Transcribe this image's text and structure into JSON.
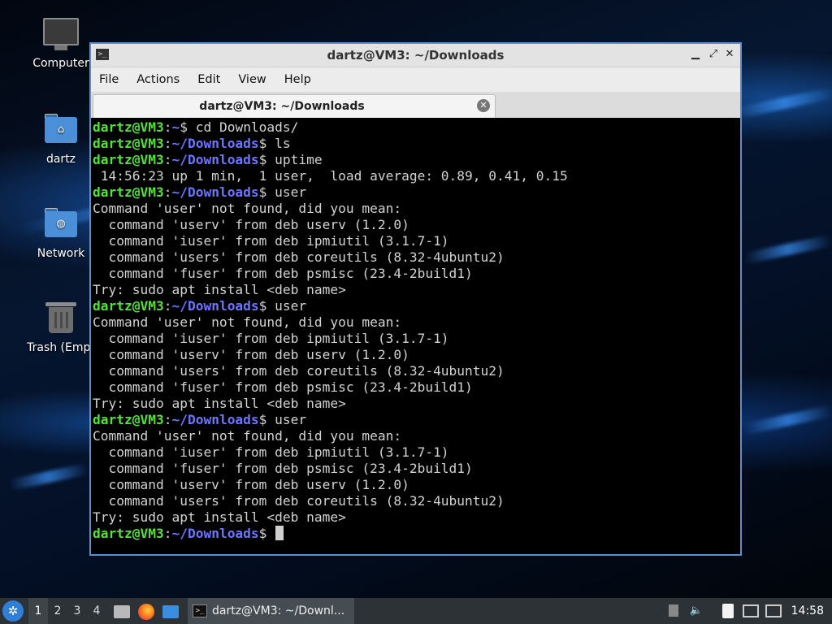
{
  "desktop": {
    "icons": [
      {
        "label": "Computer",
        "icon": "computer-icon"
      },
      {
        "label": "dartz",
        "icon": "home-folder-icon"
      },
      {
        "label": "Network",
        "icon": "network-folder-icon"
      },
      {
        "label": "Trash (Empt",
        "icon": "trash-icon"
      }
    ]
  },
  "window": {
    "title": "dartz@VM3: ~/Downloads",
    "controls": {
      "minimize": "▁",
      "maximize": "⤢",
      "close": "✕"
    },
    "menu": [
      "File",
      "Actions",
      "Edit",
      "View",
      "Help"
    ],
    "tab": {
      "label": "dartz@VM3: ~/Downloads"
    }
  },
  "terminal": {
    "lines": [
      {
        "user": "dartz@VM3",
        "path": "~",
        "cmd": " cd Downloads/"
      },
      {
        "user": "dartz@VM3",
        "path": "~/Downloads",
        "cmd": " ls"
      },
      {
        "user": "dartz@VM3",
        "path": "~/Downloads",
        "cmd": " uptime"
      },
      {
        "text": " 14:56:23 up 1 min,  1 user,  load average: 0.89, 0.41, 0.15"
      },
      {
        "user": "dartz@VM3",
        "path": "~/Downloads",
        "cmd": " user"
      },
      {
        "text": "Command 'user' not found, did you mean:"
      },
      {
        "text": "  command 'userv' from deb userv (1.2.0)"
      },
      {
        "text": "  command 'iuser' from deb ipmiutil (3.1.7-1)"
      },
      {
        "text": "  command 'users' from deb coreutils (8.32-4ubuntu2)"
      },
      {
        "text": "  command 'fuser' from deb psmisc (23.4-2build1)"
      },
      {
        "text": "Try: sudo apt install <deb name>"
      },
      {
        "user": "dartz@VM3",
        "path": "~/Downloads",
        "cmd": " user"
      },
      {
        "text": "Command 'user' not found, did you mean:"
      },
      {
        "text": "  command 'iuser' from deb ipmiutil (3.1.7-1)"
      },
      {
        "text": "  command 'userv' from deb userv (1.2.0)"
      },
      {
        "text": "  command 'users' from deb coreutils (8.32-4ubuntu2)"
      },
      {
        "text": "  command 'fuser' from deb psmisc (23.4-2build1)"
      },
      {
        "text": "Try: sudo apt install <deb name>"
      },
      {
        "user": "dartz@VM3",
        "path": "~/Downloads",
        "cmd": " user"
      },
      {
        "text": "Command 'user' not found, did you mean:"
      },
      {
        "text": "  command 'iuser' from deb ipmiutil (3.1.7-1)"
      },
      {
        "text": "  command 'fuser' from deb psmisc (23.4-2build1)"
      },
      {
        "text": "  command 'userv' from deb userv (1.2.0)"
      },
      {
        "text": "  command 'users' from deb coreutils (8.32-4ubuntu2)"
      },
      {
        "text": "Try: sudo apt install <deb name>"
      },
      {
        "user": "dartz@VM3",
        "path": "~/Downloads",
        "cmd": " ",
        "cursor": true
      }
    ]
  },
  "taskbar": {
    "workspaces": [
      "1",
      "2",
      "3",
      "4"
    ],
    "active_workspace": "1",
    "launchers": [
      "files-icon",
      "firefox-icon",
      "desktop-icon"
    ],
    "task_label": "dartz@VM3: ~/Downl...",
    "tray": [
      "clipboard-icon",
      "volume-icon",
      "notes-icon",
      "network-icon",
      "updates-icon"
    ],
    "clock": "14:58"
  },
  "colors": {
    "prompt_user": "#55e03a",
    "prompt_path": "#6e76ff",
    "window_border": "#5a8fd0"
  }
}
